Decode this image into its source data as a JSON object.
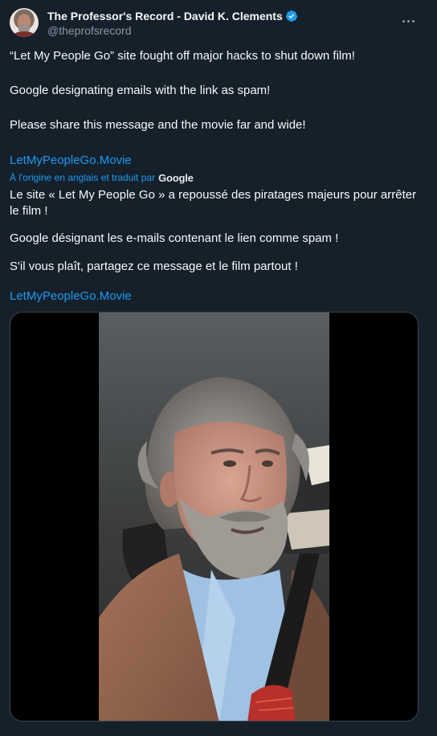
{
  "author": {
    "display_name": "The Professor's Record - David K. Clements",
    "handle": "@theprofsrecord"
  },
  "tweet": {
    "line1": "“Let My People Go” site fought off major hacks to shut down film!",
    "line2": "Google designating emails with the link as spam!",
    "line3": "Please share this message and the movie far and wide!",
    "link": "LetMyPeopleGo.Movie"
  },
  "translation": {
    "label": "À l'origine en anglais et traduit par",
    "provider": "Google",
    "line1": "Le site « Let My People Go » a repoussé des piratages majeurs pour arrêter le film !",
    "line2": "Google désignant les e-mails contenant le lien comme spam !",
    "line3": "S'il vous plaît, partagez ce message et le film partout !",
    "link": "LetMyPeopleGo.Movie"
  },
  "icons": {
    "verified": "verified-badge-icon",
    "more": "more-options-icon"
  },
  "colors": {
    "background": "#15202b",
    "link": "#1d9bf0",
    "secondary_text": "#8b98a5",
    "verified": "#1d9bf0"
  }
}
